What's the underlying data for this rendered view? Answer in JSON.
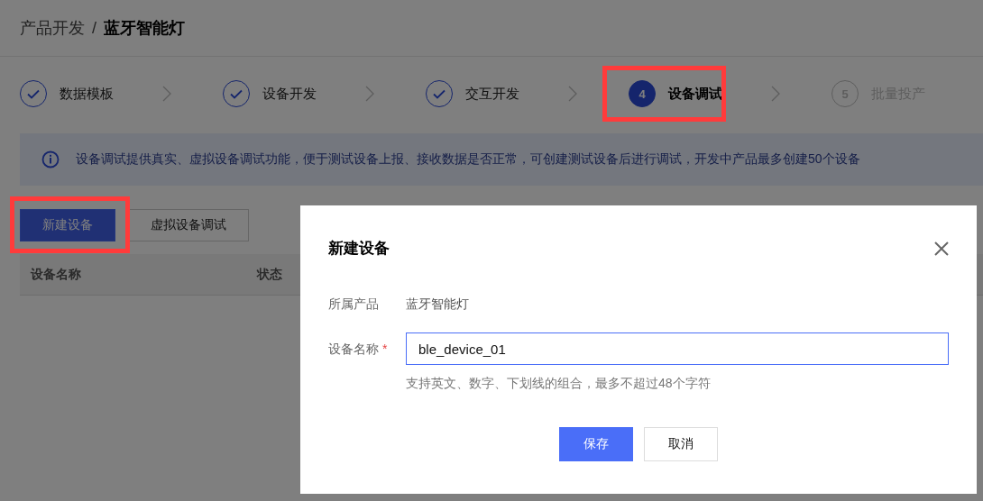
{
  "breadcrumb": {
    "parent": "产品开发",
    "separator": "/",
    "current": "蓝牙智能灯"
  },
  "steps": [
    {
      "label": "数据模板",
      "kind": "done",
      "highlighted": false
    },
    {
      "label": "设备开发",
      "kind": "done",
      "highlighted": false
    },
    {
      "label": "交互开发",
      "kind": "done",
      "highlighted": false
    },
    {
      "label": "设备调试",
      "kind": "active",
      "number": "4",
      "highlighted": true
    },
    {
      "label": "批量投产",
      "kind": "pending",
      "number": "5",
      "highlighted": false
    }
  ],
  "notice": "设备调试提供真实、虚拟设备调试功能，便于测试设备上报、接收数据是否正常，可创建测试设备后进行调试，开发中产品最多创建50个设备",
  "toolbar": [
    {
      "label": "新建设备",
      "kind": "primary",
      "highlighted": true
    },
    {
      "label": "虚拟设备调试",
      "kind": "default",
      "highlighted": false
    }
  ],
  "table": {
    "columns": [
      "设备名称",
      "状态"
    ]
  },
  "dialog": {
    "title": "新建设备",
    "fields": [
      {
        "kind": "text",
        "label": "所属产品",
        "value": "蓝牙智能灯"
      },
      {
        "kind": "input",
        "label": "设备名称",
        "value": "ble_device_01",
        "required_mark": "*",
        "hint": "支持英文、数字、下划线的组合，最多不超过48个字符"
      }
    ],
    "buttons": [
      {
        "label": "保存",
        "kind": "primary"
      },
      {
        "label": "取消",
        "kind": "default"
      }
    ]
  }
}
